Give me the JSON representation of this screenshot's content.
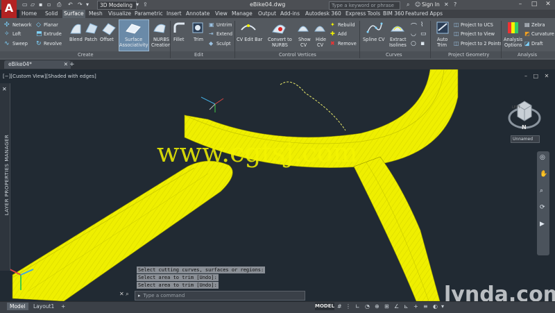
{
  "app": {
    "logo_letter": "A",
    "workspace": "3D Modeling",
    "document_title": "eBike04.dwg",
    "search_placeholder": "Type a keyword or phrase",
    "signin": "Sign In",
    "window_buttons": [
      "–",
      "□",
      "✕"
    ]
  },
  "menu_tabs": [
    "Home",
    "Solid",
    "Surface",
    "Mesh",
    "Visualize",
    "Parametric",
    "Insert",
    "Annotate",
    "View",
    "Manage",
    "Output",
    "Add-ins",
    "Autodesk 360",
    "Express Tools",
    "BIM 360",
    "Featured Apps"
  ],
  "active_tab": "Surface",
  "ribbon": {
    "create": {
      "title": "Create",
      "small_items": [
        "Network",
        "Loft",
        "Sweep",
        "Planar",
        "Extrude",
        "Revolve"
      ],
      "large_items": [
        "Blend",
        "Patch",
        "Offset"
      ],
      "surface_assoc": [
        "Surface",
        "Associativity"
      ],
      "nurbs_creation": [
        "NURBS",
        "Creation"
      ]
    },
    "edit": {
      "title": "Edit",
      "large_items": [
        "Fillet",
        "Trim"
      ],
      "small_items": [
        "Untrim",
        "Extend",
        "Sculpt"
      ]
    },
    "control_vertices": {
      "title": "Control Vertices",
      "cv_edit_bar": "CV Edit Bar",
      "convert": [
        "Convert to",
        "NURBS"
      ],
      "show_cv": [
        "Show",
        "CV"
      ],
      "hide_cv": [
        "Hide",
        "CV"
      ],
      "small_items": [
        "Rebuild",
        "Add",
        "Remove"
      ]
    },
    "curves": {
      "title": "Curves",
      "spline_cv": "Spline CV",
      "extract": [
        "Extract",
        "Isolines"
      ]
    },
    "project_geometry": {
      "title": "Project Geometry",
      "auto_trim": [
        "Auto",
        "Trim"
      ],
      "small_items": [
        "Project to UCS",
        "Project to View",
        "Project to 2 Points"
      ]
    },
    "analysis": {
      "title": "Analysis",
      "analysis_options": [
        "Analysis",
        "Options"
      ],
      "small_items": [
        "Zebra",
        "Curvature",
        "Draft"
      ]
    }
  },
  "doc_tab": "eBike04*",
  "viewport": {
    "label": "[−][Custom View][Shaded with edges]",
    "viewcube_face": "LEFT",
    "compass_letter": "N",
    "ucs_name": "Unnamed",
    "controls": [
      "–",
      "□",
      "✕"
    ],
    "layer_manager": "LAYER PROPERTIES MANAGER",
    "watermark": "www.cgtsj.com",
    "lynda": "lynda.com"
  },
  "command_history": [
    "Select cutting curves, surfaces or regions:",
    "Select area to trim [Undo]:",
    "Select area to trim [Undo]:"
  ],
  "command_placeholder": "Type a command",
  "statusbar": {
    "tabs": [
      "Model",
      "Layout1"
    ],
    "add": "+",
    "model_button": "MODEL"
  },
  "colors": {
    "accent_yellow": "#f2f200",
    "viewport_bg": "#212a33",
    "ribbon_bg": "#54595f"
  }
}
